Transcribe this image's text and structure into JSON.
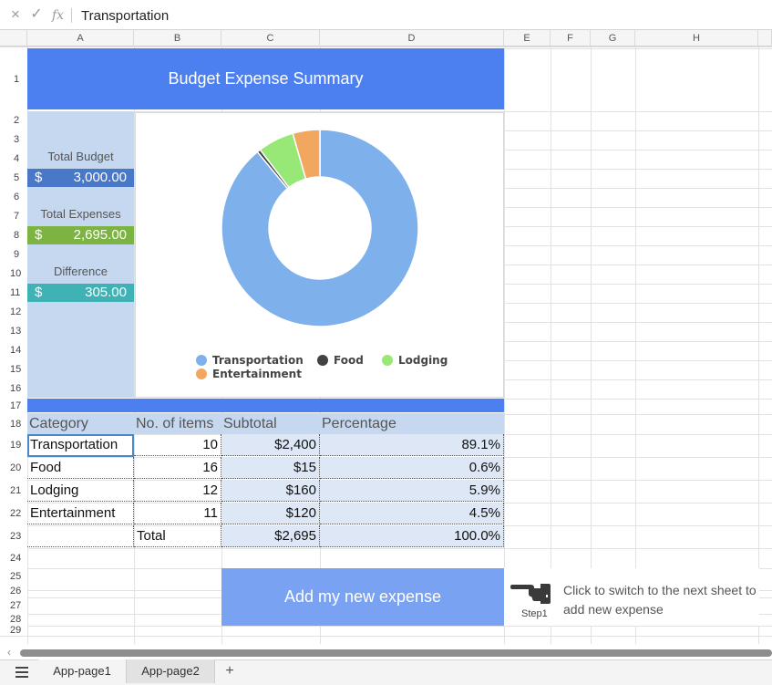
{
  "formula_bar": {
    "cancel_icon": "×",
    "confirm_icon": "✓",
    "fx_label": "fx",
    "value": "Transportation"
  },
  "columns": [
    "A",
    "B",
    "C",
    "D",
    "E",
    "F",
    "G",
    "H"
  ],
  "rows": [
    "1",
    "2",
    "3",
    "4",
    "5",
    "6",
    "7",
    "8",
    "9",
    "10",
    "11",
    "12",
    "13",
    "14",
    "15",
    "16",
    "17",
    "18",
    "19",
    "20",
    "21",
    "22",
    "23",
    "24",
    "25",
    "26",
    "27",
    "28",
    "29"
  ],
  "title": "Budget Expense Summary",
  "summary": {
    "total_budget_label": "Total Budget",
    "total_budget_currency": "$",
    "total_budget_value": "3,000.00",
    "total_expenses_label": "Total Expenses",
    "total_expenses_currency": "$",
    "total_expenses_value": "2,695.00",
    "difference_label": "Difference",
    "difference_currency": "$",
    "difference_value": "305.00",
    "colors": {
      "budget": "#4a78c8",
      "expenses": "#7cb342",
      "difference": "#3fb2b5"
    }
  },
  "chart_data": {
    "type": "pie",
    "donut": true,
    "categories": [
      "Transportation",
      "Food",
      "Lodging",
      "Entertainment"
    ],
    "values": [
      2400,
      15,
      160,
      120
    ],
    "colors": [
      "#7eb0ec",
      "#424242",
      "#97e877",
      "#f2a760"
    ],
    "legend_position": "bottom"
  },
  "table": {
    "headers": [
      "Category",
      "No. of items",
      "Subtotal",
      "Percentage"
    ],
    "rows": [
      {
        "category": "Transportation",
        "items": "10",
        "subtotal": "$2,400",
        "percentage": "89.1%"
      },
      {
        "category": "Food",
        "items": "16",
        "subtotal": "$15",
        "percentage": "0.6%"
      },
      {
        "category": "Lodging",
        "items": "12",
        "subtotal": "$160",
        "percentage": "5.9%"
      },
      {
        "category": "Entertainment",
        "items": "11",
        "subtotal": "$120",
        "percentage": "4.5%"
      }
    ],
    "total_label": "Total",
    "total_subtotal": "$2,695",
    "total_percentage": "100.0%"
  },
  "add_button_label": "Add my new expense",
  "hint": {
    "icon": "pointing-hand-icon",
    "step_label": "Step1",
    "text": "Click to switch to the next sheet to add new expense"
  },
  "sheets": {
    "tabs": [
      "App-page1",
      "App-page2"
    ],
    "active_index": 1,
    "add_label": "+"
  },
  "accent_color": "#4c80f1"
}
